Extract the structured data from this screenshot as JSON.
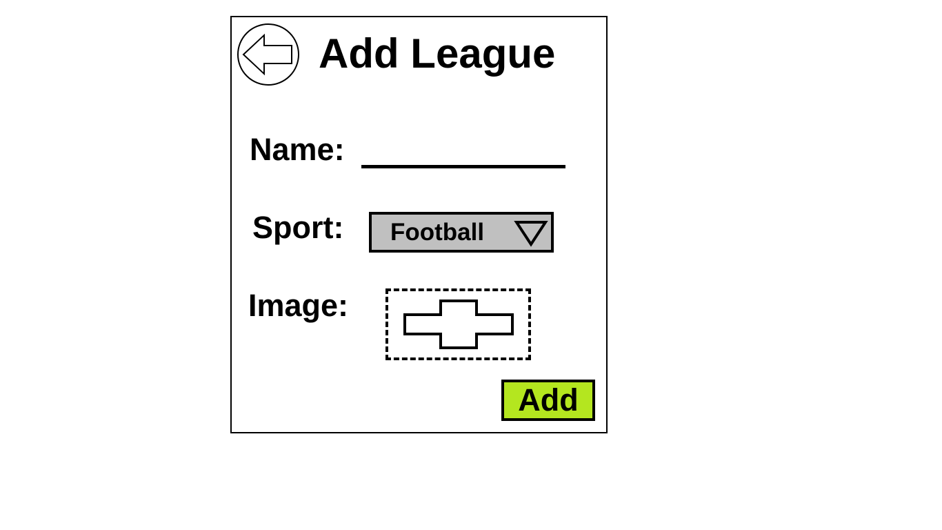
{
  "header": {
    "title": "Add League",
    "back_icon": "arrow-left-icon"
  },
  "form": {
    "name": {
      "label": "Name:",
      "value": ""
    },
    "sport": {
      "label": "Sport:",
      "selected": "Football",
      "icon": "chevron-down-icon"
    },
    "image": {
      "label": "Image:",
      "icon": "image-placeholder-icon"
    },
    "add_label": "Add"
  },
  "colors": {
    "add_button": "#b4e61f",
    "select_background": "#c0c0c0",
    "border": "#000000"
  }
}
